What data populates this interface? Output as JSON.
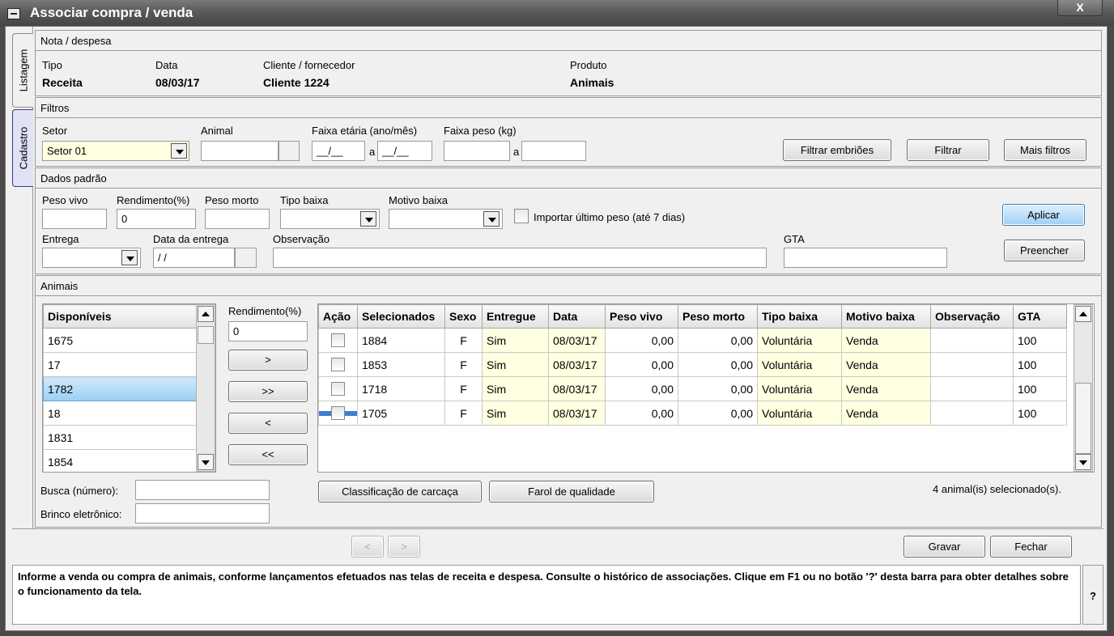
{
  "window": {
    "title": "Associar compra / venda",
    "close_glyph": "X"
  },
  "side_tabs": [
    {
      "label": "Listagem"
    },
    {
      "label": "Cadastro"
    }
  ],
  "nota": {
    "header": "Nota / despesa",
    "tipo_label": "Tipo",
    "tipo_value": "Receita",
    "data_label": "Data",
    "data_value": "08/03/17",
    "cliente_label": "Cliente / fornecedor",
    "cliente_value": "Cliente 1224",
    "produto_label": "Produto",
    "produto_value": "Animais"
  },
  "filtros": {
    "header": "Filtros",
    "setor_label": "Setor",
    "setor_value": "Setor 01",
    "animal_label": "Animal",
    "animal_value": "",
    "faixa_etaria_label": "Faixa etária (ano/mês)",
    "faixa_etaria_from": "__/__",
    "faixa_etaria_sep": "a",
    "faixa_etaria_to": "__/__",
    "faixa_peso_label": "Faixa peso (kg)",
    "faixa_peso_sep": "a",
    "btn_filtrar_embrioes": "Filtrar embriões",
    "btn_filtrar": "Filtrar",
    "btn_mais_filtros": "Mais filtros"
  },
  "dados_padrao": {
    "header": "Dados padrão",
    "peso_vivo_label": "Peso vivo",
    "peso_vivo_value": "",
    "rendimento_label": "Rendimento(%)",
    "rendimento_value": "0",
    "peso_morto_label": "Peso morto",
    "peso_morto_value": "",
    "tipo_baixa_label": "Tipo baixa",
    "tipo_baixa_value": "",
    "motivo_baixa_label": "Motivo baixa",
    "motivo_baixa_value": "",
    "importar_label": "Importar último peso (até 7 dias)",
    "entrega_label": "Entrega",
    "entrega_value": "",
    "data_entrega_label": "Data da entrega",
    "data_entrega_value": " / /",
    "observacao_label": "Observação",
    "observacao_value": "",
    "gta_label": "GTA",
    "gta_value": "",
    "btn_aplicar": "Aplicar",
    "btn_preencher": "Preencher"
  },
  "animais": {
    "header": "Animais",
    "disponiveis_header": "Disponíveis",
    "disponiveis": [
      "1675",
      "17",
      "1782",
      "18",
      "1831",
      "1854"
    ],
    "selected_available": "1782",
    "rendimento_label": "Rendimento(%)",
    "rendimento_value": "0",
    "move_buttons": [
      ">",
      ">>",
      "<",
      "<<"
    ],
    "columns": [
      "Ação",
      "Selecionados",
      "Sexo",
      "Entregue",
      "Data",
      "Peso vivo",
      "Peso morto",
      "Tipo baixa",
      "Motivo baixa",
      "Observação",
      "GTA"
    ],
    "rows": [
      {
        "selecionado": "1884",
        "sexo": "F",
        "entregue": "Sim",
        "data": "08/03/17",
        "peso_vivo": "0,00",
        "peso_morto": "0,00",
        "tipo_baixa": "Voluntária",
        "motivo_baixa": "Venda",
        "observacao": "",
        "gta": "100"
      },
      {
        "selecionado": "1853",
        "sexo": "F",
        "entregue": "Sim",
        "data": "08/03/17",
        "peso_vivo": "0,00",
        "peso_morto": "0,00",
        "tipo_baixa": "Voluntária",
        "motivo_baixa": "Venda",
        "observacao": "",
        "gta": "100"
      },
      {
        "selecionado": "1718",
        "sexo": "F",
        "entregue": "Sim",
        "data": "08/03/17",
        "peso_vivo": "0,00",
        "peso_morto": "0,00",
        "tipo_baixa": "Voluntária",
        "motivo_baixa": "Venda",
        "observacao": "",
        "gta": "100"
      },
      {
        "selecionado": "1705",
        "sexo": "F",
        "entregue": "Sim",
        "data": "08/03/17",
        "peso_vivo": "0,00",
        "peso_morto": "0,00",
        "tipo_baixa": "Voluntária",
        "motivo_baixa": "Venda",
        "observacao": "",
        "gta": "100"
      }
    ],
    "busca_label": "Busca (número):",
    "busca_value": "",
    "brinco_label": "Brinco eletrônico:",
    "brinco_value": "",
    "btn_classificacao": "Classificação de carcaça",
    "btn_farol": "Farol de qualidade",
    "count_text": "4 animal(is) selecionado(s)."
  },
  "footer": {
    "prev": "<",
    "next": ">",
    "btn_gravar": "Gravar",
    "btn_fechar": "Fechar"
  },
  "help": {
    "text": "Informe a venda ou compra de animais, conforme lançamentos efetuados nas telas de receita e despesa. Consulte o histórico de associações. Clique em F1 ou no botão '?' desta barra para obter detalhes sobre o funcionamento da tela.",
    "button": "?"
  }
}
